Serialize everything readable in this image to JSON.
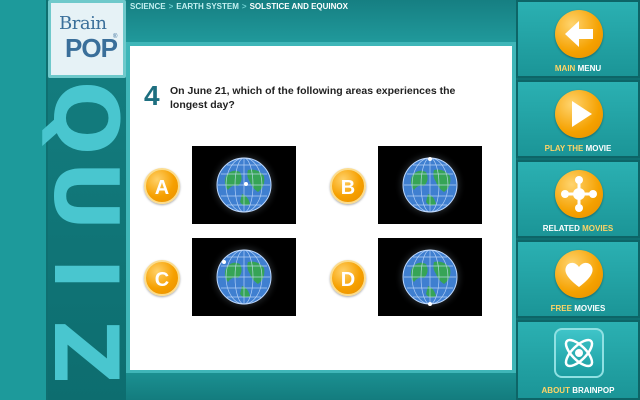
{
  "logo": {
    "line1": "Brain",
    "line2": "POP",
    "reg": "®"
  },
  "side": {
    "letters": [
      "Q",
      "U",
      "I",
      "Z"
    ]
  },
  "breadcrumb": {
    "items": [
      "SCIENCE",
      "EARTH SYSTEM",
      "SOLSTICE AND EQUINOX"
    ],
    "separator": ">"
  },
  "question": {
    "number": "4",
    "text": "On June 21, which of the following areas experiences the longest day?"
  },
  "answers": [
    {
      "letter": "A",
      "image": "globe-icon"
    },
    {
      "letter": "B",
      "image": "globe-icon"
    },
    {
      "letter": "C",
      "image": "globe-icon"
    },
    {
      "letter": "D",
      "image": "globe-icon"
    }
  ],
  "nav": [
    {
      "hl": "MAIN",
      "label": "MENU",
      "icon": "back-arrow-icon"
    },
    {
      "hl": "PLAY THE",
      "label": "MOVIE",
      "icon": "play-icon"
    },
    {
      "hl": "RELATED",
      "label": "MOVIES",
      "icon": "related-movies-icon"
    },
    {
      "hl": "FREE",
      "label": "MOVIES",
      "icon": "heart-icon"
    },
    {
      "hl": "ABOUT",
      "label": "BRAINPOP",
      "icon": "atom-icon"
    }
  ],
  "colors": {
    "accent": "#f5a100",
    "teal": "#1d9a9b",
    "question_number": "#1e6f80"
  }
}
